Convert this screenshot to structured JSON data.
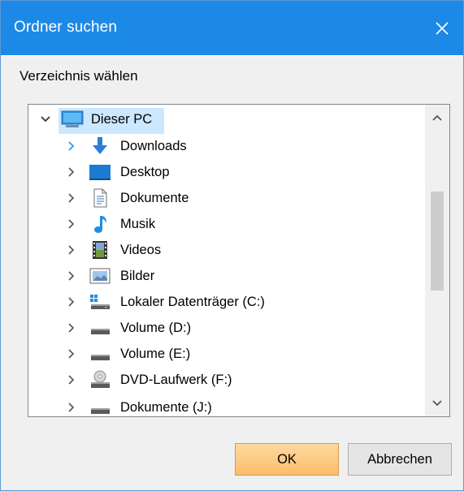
{
  "window": {
    "title": "Ordner suchen"
  },
  "prompt": "Verzeichnis wählen",
  "tree": {
    "root": {
      "label": "Dieser PC",
      "expanded": true,
      "selected": true
    },
    "children": [
      {
        "label": "Downloads",
        "icon": "downloads-arrow-icon",
        "chevron_color": "#2c9ceb"
      },
      {
        "label": "Desktop",
        "icon": "desktop-folder-icon"
      },
      {
        "label": "Dokumente",
        "icon": "document-icon"
      },
      {
        "label": "Musik",
        "icon": "music-note-icon"
      },
      {
        "label": "Videos",
        "icon": "film-icon"
      },
      {
        "label": "Bilder",
        "icon": "picture-icon"
      },
      {
        "label": "Lokaler Datenträger (C:)",
        "icon": "windows-drive-icon"
      },
      {
        "label": "Volume (D:)",
        "icon": "drive-icon"
      },
      {
        "label": "Volume (E:)",
        "icon": "drive-icon"
      },
      {
        "label": "DVD-Laufwerk (F:)",
        "icon": "dvd-drive-icon"
      },
      {
        "label": "Dokumente (J:)",
        "icon": "drive-icon"
      }
    ]
  },
  "buttons": {
    "ok": "OK",
    "cancel": "Abbrechen"
  },
  "colors": {
    "titlebar": "#1c89e6",
    "selection": "#cce8ff",
    "ok_button": "#fcbd6a"
  }
}
